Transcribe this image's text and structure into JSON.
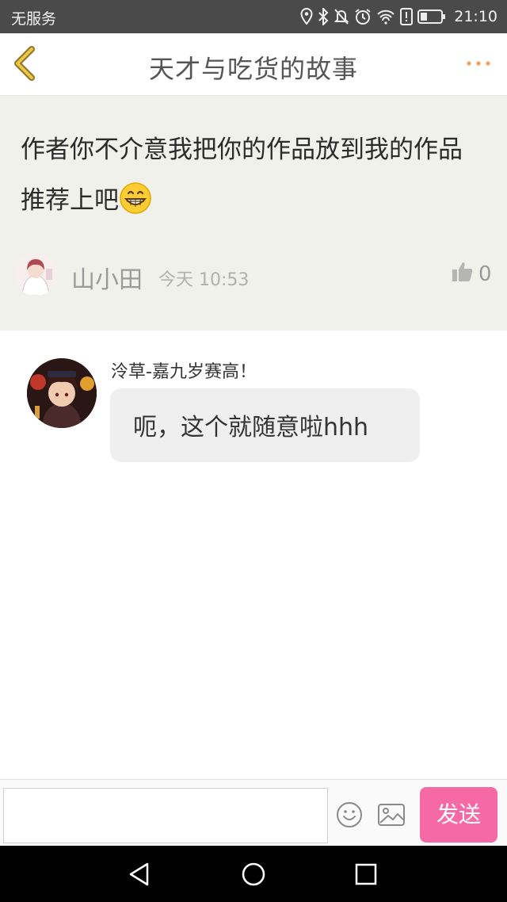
{
  "status_bar": {
    "carrier": "无服务",
    "time": "21:10",
    "icons": [
      "location-icon",
      "bluetooth-icon",
      "mute-icon",
      "alarm-icon",
      "wifi-icon",
      "alert-icon",
      "battery-icon"
    ]
  },
  "header": {
    "title": "天才与吃货的故事",
    "accent_color": "#f5a05a"
  },
  "post": {
    "text": "作者你不介意我把你的作品放到我的作品推荐上吧",
    "emoji": "grinning-face-emoji",
    "author": "山小田",
    "time": "今天 10:53",
    "likes": "0"
  },
  "reply": {
    "author": "泠草-嘉九岁赛高！",
    "message": "呃，这个就随意啦hhh"
  },
  "composer": {
    "placeholder": "",
    "send_label": "发送",
    "send_color": "#f56aa5"
  }
}
